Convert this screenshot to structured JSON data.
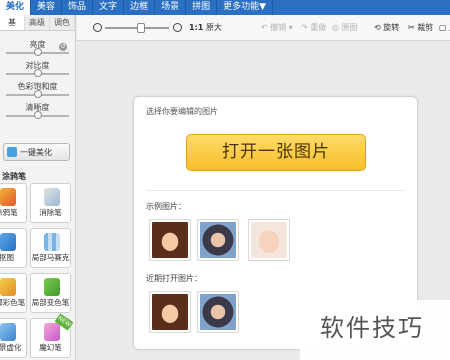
{
  "top_menu": [
    "美化",
    "美容",
    "饰品",
    "文字",
    "边框",
    "场景",
    "拼图",
    "更多功能▼"
  ],
  "left_tabs": [
    "基",
    "高级",
    "调色"
  ],
  "adjust": {
    "reset_glyph": "↺",
    "items": [
      "亮度",
      "对比度",
      "色彩饱和度",
      "清晰度"
    ],
    "levels": [
      0.5,
      0.5,
      0.5,
      0.5
    ]
  },
  "onekey_label": "一键美化",
  "brush_title": "涂鸦笔",
  "tools": [
    "涂鸦笔",
    "消除笔",
    "抠图",
    "局部马赛克",
    "局部彩色笔",
    "局部变色笔",
    "背景虚化",
    "魔幻笔"
  ],
  "new_badge": "NEW",
  "toolbar": {
    "ratio_label": "1:1",
    "original_label": "原大",
    "undo_label": "撤销",
    "redo_label": "重做",
    "compare_label": "原图",
    "rotate_label": "旋转",
    "crop_label": "裁剪",
    "resize_label": "尺"
  },
  "dialog": {
    "title": "选择你要编辑的图片",
    "open_button": "打开一张图片",
    "sample_label": "示例图片：",
    "recent_label": "近期打开图片："
  },
  "watermark": "软件技巧",
  "colors": {
    "menu_blue": "#2a6fc1",
    "button_yellow": "#f8bd2b"
  }
}
